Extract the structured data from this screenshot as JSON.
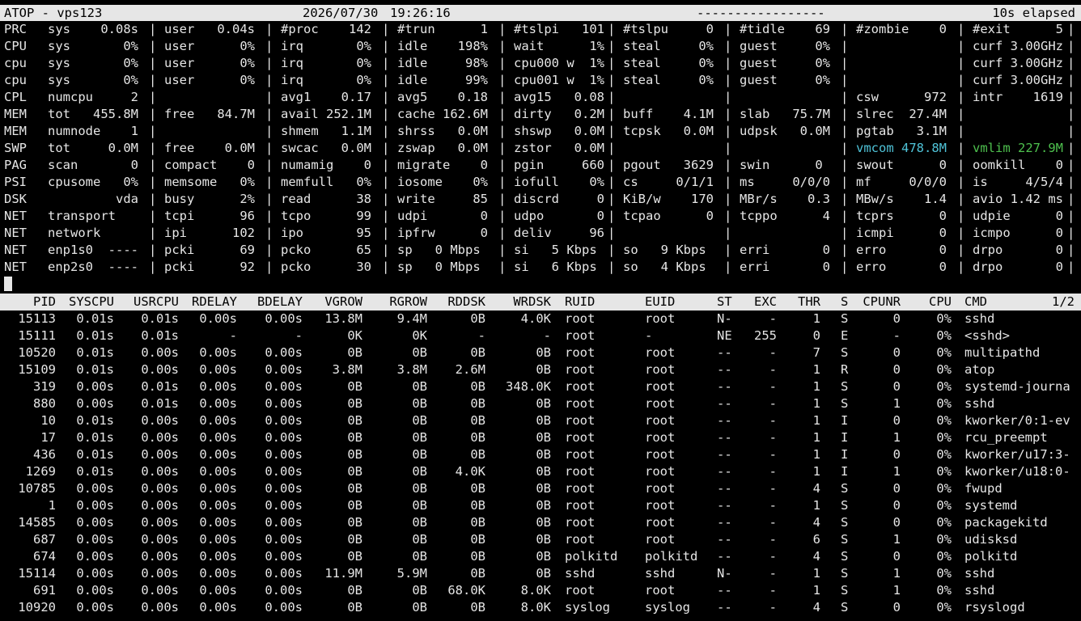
{
  "header": {
    "title": "ATOP - vps123",
    "date": "2026/07/30",
    "time": "19:26:16",
    "dashes": "-----------------",
    "elapsed": "10s elapsed"
  },
  "system_rows": [
    {
      "label": "PRC",
      "fields": [
        "sys    0.08s",
        "user   0.04s",
        "#proc    142",
        "#trun      1",
        "#tslpi   101",
        "#tslpu     0",
        "#tidle    69",
        "#zombie    0",
        "#exit      5"
      ]
    },
    {
      "label": "CPU",
      "fields": [
        "sys       0%",
        "user      0%",
        "irq       0%",
        "idle    198%",
        "wait      1%",
        "steal     0%",
        "guest     0%",
        "",
        "curf 3.00GHz"
      ]
    },
    {
      "label": "cpu",
      "fields": [
        "sys       0%",
        "user      0%",
        "irq       0%",
        "idle     98%",
        "cpu000 w  1%",
        "steal     0%",
        "guest     0%",
        "",
        "curf 3.00GHz"
      ]
    },
    {
      "label": "cpu",
      "fields": [
        "sys       0%",
        "user      0%",
        "irq       0%",
        "idle     99%",
        "cpu001 w  1%",
        "steal     0%",
        "guest     0%",
        "",
        "curf 3.00GHz"
      ]
    },
    {
      "label": "CPL",
      "fields": [
        "numcpu     2",
        "",
        "avg1    0.17",
        "avg5    0.18",
        "avg15   0.08",
        "",
        "",
        "csw      972",
        "intr    1619"
      ]
    },
    {
      "label": "MEM",
      "fields": [
        "tot   455.8M",
        "free   84.7M",
        "avail 252.1M",
        "cache 162.6M",
        "dirty   0.2M",
        "buff    4.1M",
        "slab   75.7M",
        "slrec  27.4M",
        ""
      ]
    },
    {
      "label": "MEM",
      "fields": [
        "numnode    1",
        "",
        "shmem   1.1M",
        "shrss   0.0M",
        "shswp   0.0M",
        "tcpsk   0.0M",
        "udpsk   0.0M",
        "pgtab   3.1M",
        ""
      ]
    },
    {
      "label": "SWP",
      "fields": [
        "tot     0.0M",
        "free    0.0M",
        "swcac   0.0M",
        "zswap   0.0M",
        "zstor   0.0M",
        "",
        "",
        "vmcom 478.8M",
        "vmlim 227.9M"
      ]
    },
    {
      "label": "PAG",
      "fields": [
        "scan       0",
        "compact    0",
        "numamig    0",
        "migrate    0",
        "pgin     660",
        "pgout   3629",
        "swin      0",
        "swout      0",
        "oomkill    0"
      ]
    },
    {
      "label": "PSI",
      "fields": [
        "cpusome   0%",
        "memsome   0%",
        "memfull   0%",
        "iosome    0%",
        "iofull    0%",
        "cs     0/1/1",
        "ms     0/0/0",
        "mf     0/0/0",
        "is     4/5/4"
      ]
    },
    {
      "label": "DSK",
      "fields": [
        "         vda",
        "busy      2%",
        "read      38",
        "write     85",
        "discrd     0",
        "KiB/w    170",
        "MBr/s    0.3",
        "MBw/s    1.4",
        "avio 1.42 ms"
      ]
    },
    {
      "label": "NET",
      "fields": [
        "transport",
        "tcpi      96",
        "tcpo      99",
        "udpi       0",
        "udpo       0",
        "tcpao      0",
        "tcppo      4",
        "tcprs      0",
        "udpie      0"
      ]
    },
    {
      "label": "NET",
      "fields": [
        "network",
        "ipi      102",
        "ipo       95",
        "ipfrw      0",
        "deliv     96",
        "",
        "",
        "icmpi      0",
        "icmpo      0"
      ]
    },
    {
      "label": "NET",
      "fields": [
        "enp1s0  ----",
        "pcki      69",
        "pcko      65",
        "sp   0 Mbps",
        "si   5 Kbps",
        "so   9 Kbps",
        "erri       0",
        "erro       0",
        "drpo       0"
      ]
    },
    {
      "label": "NET",
      "fields": [
        "enp2s0  ----",
        "pcki      92",
        "pcko      30",
        "sp   0 Mbps",
        "si   6 Kbps",
        "so   4 Kbps",
        "erri       0",
        "erro       0",
        "drpo       0"
      ]
    }
  ],
  "colors": {
    "vmcom": "#4fc3d8",
    "vmlim": "#4ec04e"
  },
  "proc_header": {
    "columns": [
      "PID",
      "SYSCPU",
      "USRCPU",
      "RDELAY",
      "BDELAY",
      "VGROW",
      "RGROW",
      "RDDSK",
      "WRDSK",
      "RUID",
      "EUID",
      "ST",
      "EXC",
      "THR",
      "S",
      "CPUNR",
      "CPU",
      "CMD"
    ],
    "page": "1/2"
  },
  "processes": [
    [
      "15113",
      "0.01s",
      "0.01s",
      "0.00s",
      "0.00s",
      "13.8M",
      "9.4M",
      "0B",
      "4.0K",
      "root",
      "root",
      "N-",
      "-",
      "1",
      "S",
      "0",
      "0%",
      "sshd"
    ],
    [
      "15111",
      "0.01s",
      "0.01s",
      "-",
      "-",
      "0K",
      "0K",
      "-",
      "-",
      "root",
      "-",
      "NE",
      "255",
      "0",
      "E",
      "-",
      "0%",
      "<sshd>"
    ],
    [
      "10520",
      "0.01s",
      "0.00s",
      "0.00s",
      "0.00s",
      "0B",
      "0B",
      "0B",
      "0B",
      "root",
      "root",
      "--",
      "-",
      "7",
      "S",
      "0",
      "0%",
      "multipathd"
    ],
    [
      "15109",
      "0.01s",
      "0.00s",
      "0.00s",
      "0.00s",
      "3.8M",
      "3.8M",
      "2.6M",
      "0B",
      "root",
      "root",
      "--",
      "-",
      "1",
      "R",
      "0",
      "0%",
      "atop"
    ],
    [
      "319",
      "0.00s",
      "0.01s",
      "0.00s",
      "0.00s",
      "0B",
      "0B",
      "0B",
      "348.0K",
      "root",
      "root",
      "--",
      "-",
      "1",
      "S",
      "0",
      "0%",
      "systemd-journa"
    ],
    [
      "880",
      "0.00s",
      "0.01s",
      "0.00s",
      "0.00s",
      "0B",
      "0B",
      "0B",
      "0B",
      "root",
      "root",
      "--",
      "-",
      "1",
      "S",
      "1",
      "0%",
      "sshd"
    ],
    [
      "10",
      "0.01s",
      "0.00s",
      "0.00s",
      "0.00s",
      "0B",
      "0B",
      "0B",
      "0B",
      "root",
      "root",
      "--",
      "-",
      "1",
      "I",
      "0",
      "0%",
      "kworker/0:1-ev"
    ],
    [
      "17",
      "0.01s",
      "0.00s",
      "0.00s",
      "0.00s",
      "0B",
      "0B",
      "0B",
      "0B",
      "root",
      "root",
      "--",
      "-",
      "1",
      "I",
      "1",
      "0%",
      "rcu_preempt"
    ],
    [
      "436",
      "0.01s",
      "0.00s",
      "0.00s",
      "0.00s",
      "0B",
      "0B",
      "0B",
      "0B",
      "root",
      "root",
      "--",
      "-",
      "1",
      "I",
      "0",
      "0%",
      "kworker/u17:3-"
    ],
    [
      "1269",
      "0.01s",
      "0.00s",
      "0.00s",
      "0.00s",
      "0B",
      "0B",
      "4.0K",
      "0B",
      "root",
      "root",
      "--",
      "-",
      "1",
      "I",
      "1",
      "0%",
      "kworker/u18:0-"
    ],
    [
      "10785",
      "0.00s",
      "0.00s",
      "0.00s",
      "0.00s",
      "0B",
      "0B",
      "0B",
      "0B",
      "root",
      "root",
      "--",
      "-",
      "4",
      "S",
      "0",
      "0%",
      "fwupd"
    ],
    [
      "1",
      "0.00s",
      "0.00s",
      "0.00s",
      "0.00s",
      "0B",
      "0B",
      "0B",
      "0B",
      "root",
      "root",
      "--",
      "-",
      "1",
      "S",
      "0",
      "0%",
      "systemd"
    ],
    [
      "14585",
      "0.00s",
      "0.00s",
      "0.00s",
      "0.00s",
      "0B",
      "0B",
      "0B",
      "0B",
      "root",
      "root",
      "--",
      "-",
      "4",
      "S",
      "0",
      "0%",
      "packagekitd"
    ],
    [
      "687",
      "0.00s",
      "0.00s",
      "0.00s",
      "0.00s",
      "0B",
      "0B",
      "0B",
      "0B",
      "root",
      "root",
      "--",
      "-",
      "6",
      "S",
      "1",
      "0%",
      "udisksd"
    ],
    [
      "674",
      "0.00s",
      "0.00s",
      "0.00s",
      "0.00s",
      "0B",
      "0B",
      "0B",
      "0B",
      "polkitd",
      "polkitd",
      "--",
      "-",
      "4",
      "S",
      "0",
      "0%",
      "polkitd"
    ],
    [
      "15114",
      "0.00s",
      "0.00s",
      "0.00s",
      "0.00s",
      "11.9M",
      "5.9M",
      "0B",
      "0B",
      "sshd",
      "sshd",
      "N-",
      "-",
      "1",
      "S",
      "1",
      "0%",
      "sshd"
    ],
    [
      "691",
      "0.00s",
      "0.00s",
      "0.00s",
      "0.00s",
      "0B",
      "0B",
      "68.0K",
      "8.0K",
      "root",
      "root",
      "--",
      "-",
      "1",
      "S",
      "1",
      "0%",
      "sshd"
    ],
    [
      "10920",
      "0.00s",
      "0.00s",
      "0.00s",
      "0.00s",
      "0B",
      "0B",
      "0B",
      "8.0K",
      "syslog",
      "syslog",
      "--",
      "-",
      "4",
      "S",
      "0",
      "0%",
      "rsyslogd"
    ]
  ]
}
